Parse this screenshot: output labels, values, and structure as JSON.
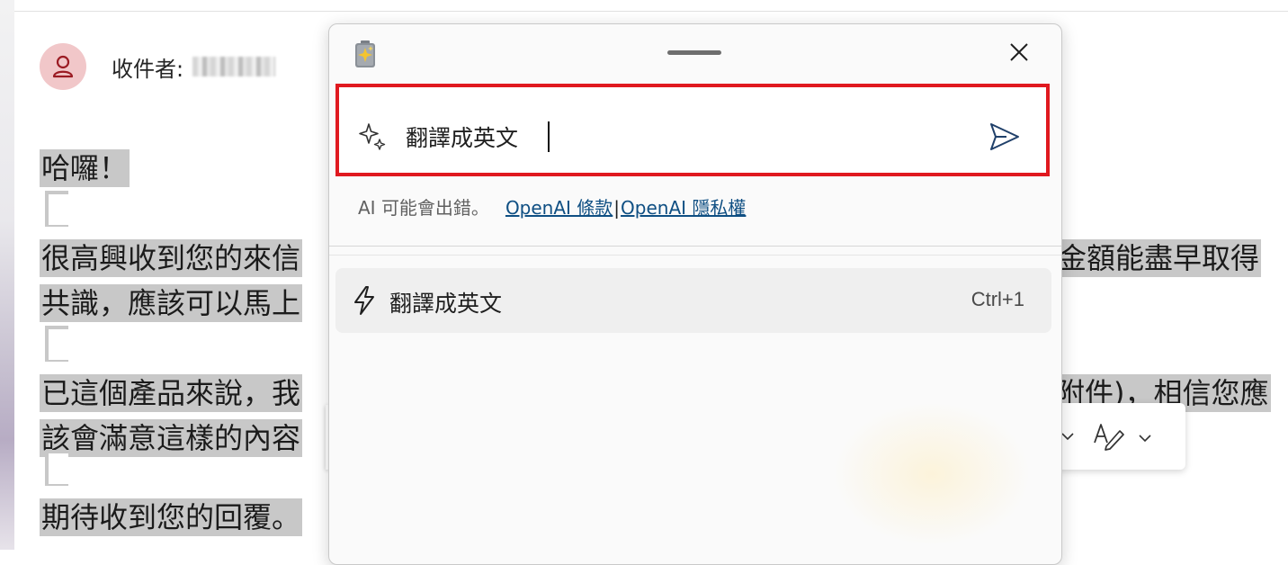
{
  "email": {
    "recipient_label": "收件者:",
    "lines": [
      "哈囉！",
      "很高興收到您的來信",
      "金額能盡早取得",
      "共識，應該可以馬上",
      "已這個產品來說，我",
      "附件)，相信您應",
      "該會滿意這樣的內容",
      "期待收到您的回覆。"
    ]
  },
  "copilot": {
    "prompt_value": "翻譯成英文",
    "disclaimer": {
      "text": "AI 可能會出錯。",
      "terms_link": "OpenAI 條款",
      "separator": "|",
      "privacy_link": "OpenAI 隱私權"
    },
    "suggestion": {
      "label": "翻譯成英文",
      "shortcut": "Ctrl+1"
    }
  },
  "colors": {
    "highlight": "#c8c8c8",
    "focus_frame": "#e0191f",
    "link": "#0f4f83",
    "avatar_bg": "#f1c7c9"
  },
  "icons": [
    "person-icon",
    "copilot-app-icon",
    "close-icon",
    "sparkle-icon",
    "send-icon",
    "bolt-icon",
    "chevron-down-icon",
    "handwriting-icon"
  ]
}
